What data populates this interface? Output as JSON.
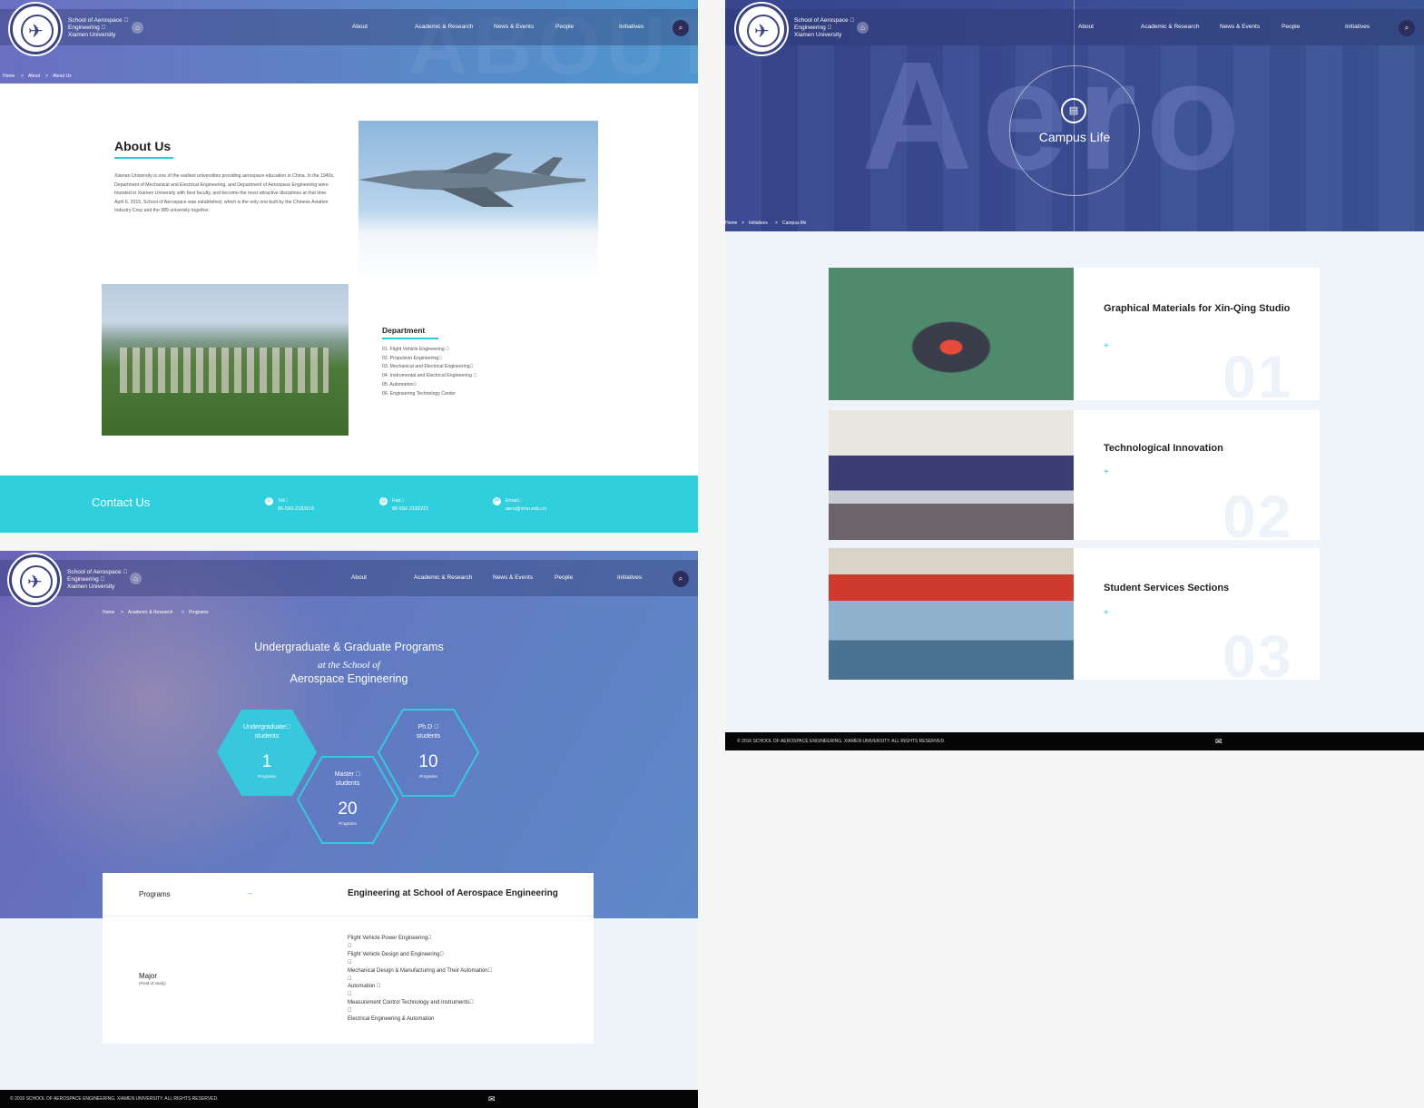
{
  "header": {
    "school_line1": "School of Aerospace \u0000",
    "school_line2": "Engineering \u0000",
    "school_line3": "Xiamen University",
    "menu": [
      "About",
      "Academic & Research",
      "News & Events",
      "People",
      "Initiatives"
    ]
  },
  "about_page": {
    "watermark": "ABOUT",
    "breadcrumb": [
      "Home",
      ">",
      "About",
      ">",
      "About Us"
    ],
    "title": "About Us",
    "text": "Xiamen University is one of the earliest universities providing aerospace education in China. In the 1940s, Department of Mechanical and Electrical Engineering, and Department of Aerospace Engineering were founded in Xiamen University with best faculty, and become the most attractive disciplines at that time. April 6, 2015, School of Aerospace was established, which is the only one built by the Chinese Aviation Industry Corp and the 985 university together.",
    "department_title": "Department",
    "departments": [
      "01. Flight Vehicle Engineering \u0000",
      "02. Propulsion Engineering\u0000",
      "03. Mechanical and Electrical Engineering\u0000",
      "04. Instrumental and Electrical Engineering \u0000",
      "05. Automation\u0000",
      "06. Engineering Technology Center"
    ],
    "contact_title": "Contact Us",
    "contacts": [
      {
        "label": "Tel\u0000",
        "value": "86-592-2183216",
        "icon": "phone-icon"
      },
      {
        "label": "Fax\u0000",
        "value": "86-592-2182221",
        "icon": "fax-icon"
      },
      {
        "label": "Email\u0000",
        "value": "aero@xmu.edu.cn",
        "icon": "email-icon"
      }
    ]
  },
  "programs_page": {
    "breadcrumb": [
      "Home",
      ">",
      "Academic & Research",
      ">",
      "Programs"
    ],
    "title_line1": "Undergraduate & Graduate Programs",
    "title_line2": "at the School of",
    "title_line3": "Aerospace Engineering",
    "hexes": [
      {
        "label1": "Undergraduate\u0000",
        "label2": "students",
        "count": "1",
        "unit": "Programs"
      },
      {
        "label1": "Master \u0000",
        "label2": "students",
        "count": "20",
        "unit": "Programs"
      },
      {
        "label1": "Ph.D \u0000",
        "label2": "students",
        "count": "10",
        "unit": "Programs"
      }
    ],
    "table_head_left": "Programs",
    "table_head_dash": "–",
    "table_head_right": "Engineering at School of Aerospace Engineering",
    "major_label": "Major",
    "major_sub": "(Field of study)",
    "majors": [
      "Flight Vehicle Power Engineering\u0000",
      "\u0000",
      "Flight Vehicle Design and Engineering\u0000",
      "\u0000",
      "Mechanical Design & Manufacturing and Their Automation\u0000",
      "\u0000",
      "Automation \u0000",
      "\u0000",
      "Measurement Control Technology and Instruments\u0000",
      "\u0000",
      "Electrical Engineering & Automation"
    ],
    "footer": "© 2016 SCHOOL OF AEROSPACE ENGINEERING, XIAMEN UNIVERSITY. ALL RIGHTS RESERVED."
  },
  "campus_page": {
    "watermark": "Aero",
    "title": "Campus Life",
    "breadcrumb": [
      "Home",
      ">",
      "Initiatives",
      ">",
      "Campus life"
    ],
    "cards": [
      {
        "title": "Graphical Materials for Xin-Qing Studio",
        "plus": "+",
        "num": "01"
      },
      {
        "title": "Technological Innovation",
        "plus": "+",
        "num": "02"
      },
      {
        "title": "Student Services Sections",
        "plus": "+",
        "num": "03"
      }
    ],
    "footer": "© 2016 SCHOOL OF AEROSPACE ENGINEERING, XIAMEN UNIVERSITY. ALL RIGHTS RESERVED."
  },
  "colors": {
    "accent": "#2ec9dd",
    "dark": "#050505",
    "hero": "#5b86c6"
  }
}
